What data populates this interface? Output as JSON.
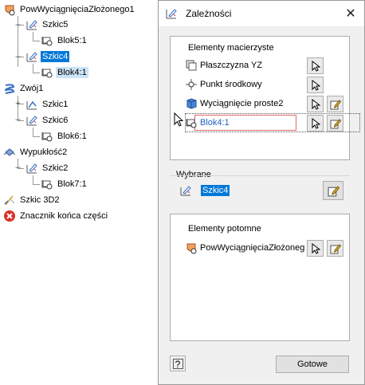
{
  "tree": {
    "root": "PowWyciągnięciaZłożonego1",
    "nodes": {
      "szkic5": "Szkic5",
      "blok5": "Blok5:1",
      "szkic4": "Szkic4",
      "blok4": "Blok4:1",
      "zwoj1": "Zwój1",
      "szkic1": "Szkic1",
      "szkic6": "Szkic6",
      "blok6": "Blok6:1",
      "wypuklosc2": "Wypukłość2",
      "szkic2": "Szkic2",
      "blok7": "Blok7:1",
      "szkic3d2": "Szkic 3D2",
      "end_marker": "Znacznik końca części"
    }
  },
  "dialog": {
    "title": "Zależności",
    "close_glyph": "✕",
    "parents": {
      "header": "Elementy macierzyste",
      "items": [
        "Płaszczyzna YZ",
        "Punkt środkowy",
        "Wyciągnięcie proste2",
        "Blok4:1"
      ]
    },
    "selected": {
      "header": "Wybrane",
      "value": "Szkic4"
    },
    "children": {
      "header": "Elementy potomne",
      "items": [
        "PowWyciągnięciaZłożoneg"
      ]
    },
    "help_glyph": "?",
    "done_label": "Gotowe"
  },
  "colors": {
    "selection": "#0078d7",
    "highlight_border": "#e06b6b",
    "link_text": "#1f5fbf"
  }
}
